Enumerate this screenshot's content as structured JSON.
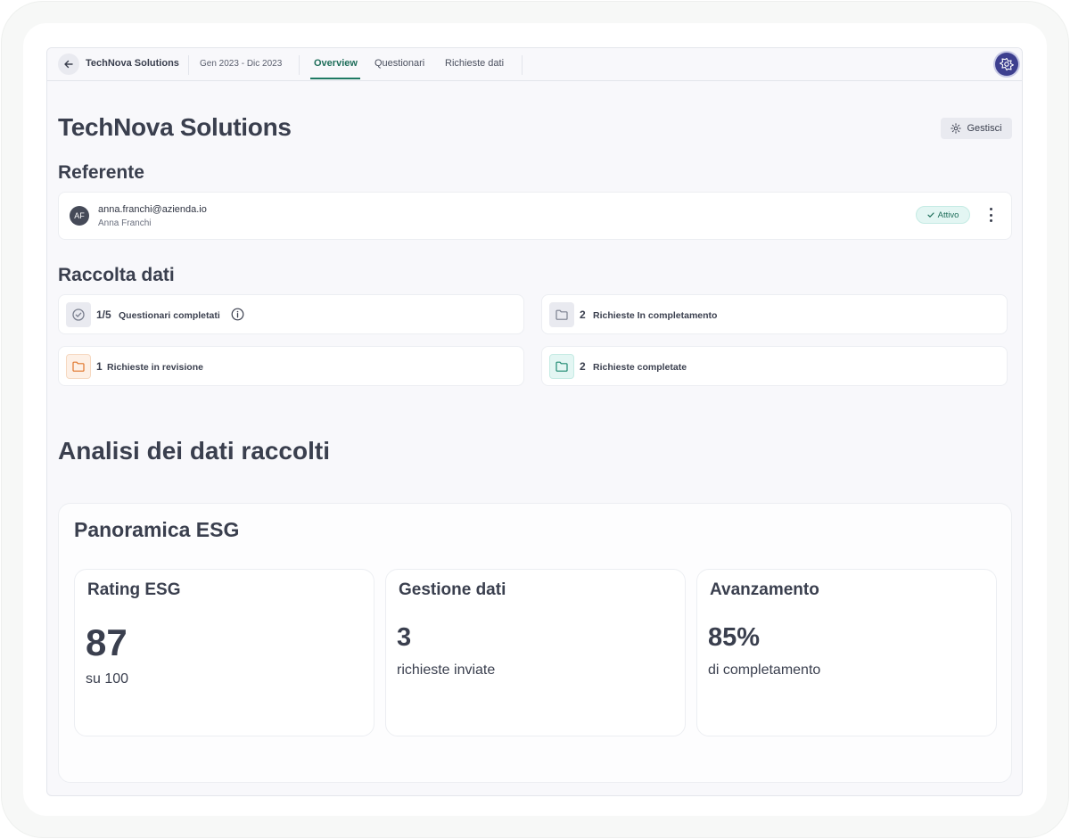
{
  "topbar": {
    "company": "TechNova Solutions",
    "period": "Gen 2023 - Dic 2023",
    "tabs": [
      "Overview",
      "Questionari",
      "Richieste dati"
    ]
  },
  "page": {
    "title": "TechNova Solutions",
    "manage_label": "Gestisci"
  },
  "referente": {
    "title": "Referente",
    "initials": "AF",
    "email": "anna.franchi@azienda.io",
    "name": "Anna Franchi",
    "status": "Attivo"
  },
  "raccolta": {
    "title": "Raccolta dati",
    "stats": [
      {
        "value": "1/5",
        "label": "Questionari completati"
      },
      {
        "value": "2",
        "label": "Richieste In completamento"
      },
      {
        "value": "1",
        "label": "Richieste in revisione"
      },
      {
        "value": "2",
        "label": "Richieste completate"
      }
    ]
  },
  "analisi": {
    "title": "Analisi dei dati raccolti",
    "panel_title": "Panoramica ESG",
    "metrics": [
      {
        "title": "Rating ESG",
        "value": "87",
        "sub": "su 100"
      },
      {
        "title": "Gestione dati",
        "value": "3",
        "sub": "richieste inviate"
      },
      {
        "title": "Avanzamento",
        "value": "85%",
        "sub": "di completamento"
      }
    ]
  },
  "colors": {
    "accent": "#1f7a63",
    "orange": "#e0762b",
    "teal": "#1f8a72"
  }
}
